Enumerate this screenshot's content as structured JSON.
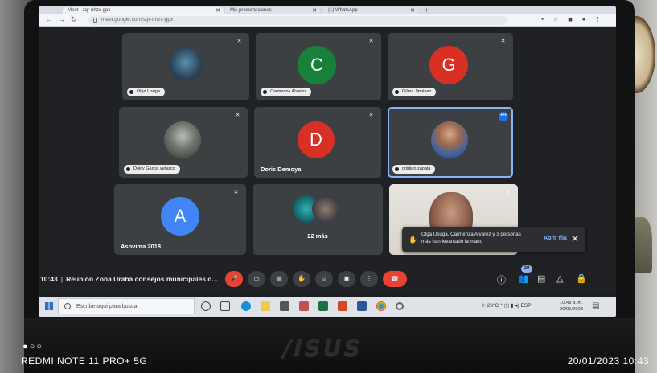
{
  "browser": {
    "tabs": [
      {
        "label": "Meet - zqr-uhzx-gpx"
      },
      {
        "label": "Mis presentaciones"
      },
      {
        "label": "(1) WhatsApp"
      }
    ],
    "url": "meet.google.com/sqr-uhzx-gpx"
  },
  "meet": {
    "tiles": [
      {
        "name": "Olga Usuga",
        "type": "photo",
        "mic_off": true
      },
      {
        "name": "Carmenza Alvarez",
        "type": "letter",
        "letter": "C",
        "color": "#188038",
        "mic_off": true
      },
      {
        "name": "Gilma Jiménez",
        "type": "letter",
        "letter": "G",
        "color": "#d93025",
        "mic_off": true
      },
      {
        "name": "Delcy Garcia velazco",
        "type": "photo",
        "mic_off": true
      },
      {
        "name": "Doris Demoya",
        "type": "letter",
        "letter": "D",
        "color": "#d93025",
        "mic_off": true
      },
      {
        "name": "cristian zapata",
        "type": "photo",
        "mic_off": false,
        "active": true
      },
      {
        "name": "Asovima 2018",
        "type": "letter",
        "letter": "A",
        "color": "#4285f4",
        "mic_off": true
      },
      {
        "name": "22 más",
        "type": "group",
        "mic_off": false
      },
      {
        "name": "",
        "type": "video",
        "mic_off": true
      }
    ],
    "toast": {
      "text": "Olga Usuga, Carmenza Alvarez y 3 personas más han levantado la mano",
      "action": "Abrir fila"
    },
    "controls": {
      "time": "10:43",
      "meeting_title": "Reunión Zona Urabá consejos municipales d...",
      "participants_badge": "29"
    }
  },
  "taskbar": {
    "search_placeholder": "Escribe aquí para buscar",
    "weather": "23°C",
    "language": "ESP",
    "time": "10:43 a. m.",
    "date": "20/01/2023"
  },
  "watermark": {
    "model": "REDMI NOTE 11 PRO+ 5G",
    "datetime": "20/01/2023  10:43"
  },
  "colors": {
    "meet_bg": "#202124",
    "tile_bg": "#3c4043",
    "hangup_red": "#ea4335",
    "accent_blue": "#8ab4f8"
  }
}
